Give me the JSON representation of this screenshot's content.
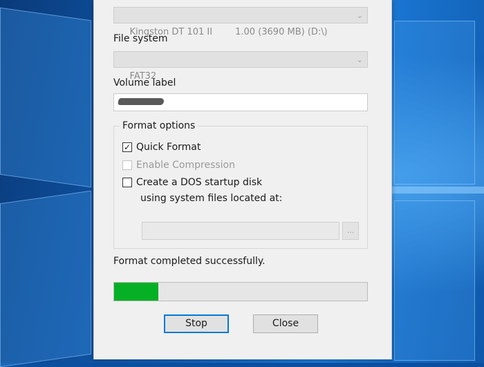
{
  "device": {
    "value": "Kingston DT 101 II        1.00 (3690 MB) (D:\\)"
  },
  "file_system": {
    "label": "File system",
    "value": "FAT32"
  },
  "volume_label": {
    "label": "Volume label"
  },
  "format_options": {
    "title": "Format options",
    "quick_format": {
      "label": "Quick Format",
      "checked": true
    },
    "enable_compression": {
      "label": "Enable Compression",
      "checked": false,
      "disabled": true
    },
    "dos_startup": {
      "label": "Create a DOS startup disk",
      "checked": false
    },
    "dos_subtext": "using system files located at:",
    "browse_label": "..."
  },
  "status": {
    "text": "Format completed successfully."
  },
  "progress": {
    "fraction": 0.175,
    "color": "#06b025"
  },
  "buttons": {
    "stop": "Stop",
    "close": "Close"
  },
  "icons": {
    "check": "✓",
    "chevron": "⌄"
  }
}
